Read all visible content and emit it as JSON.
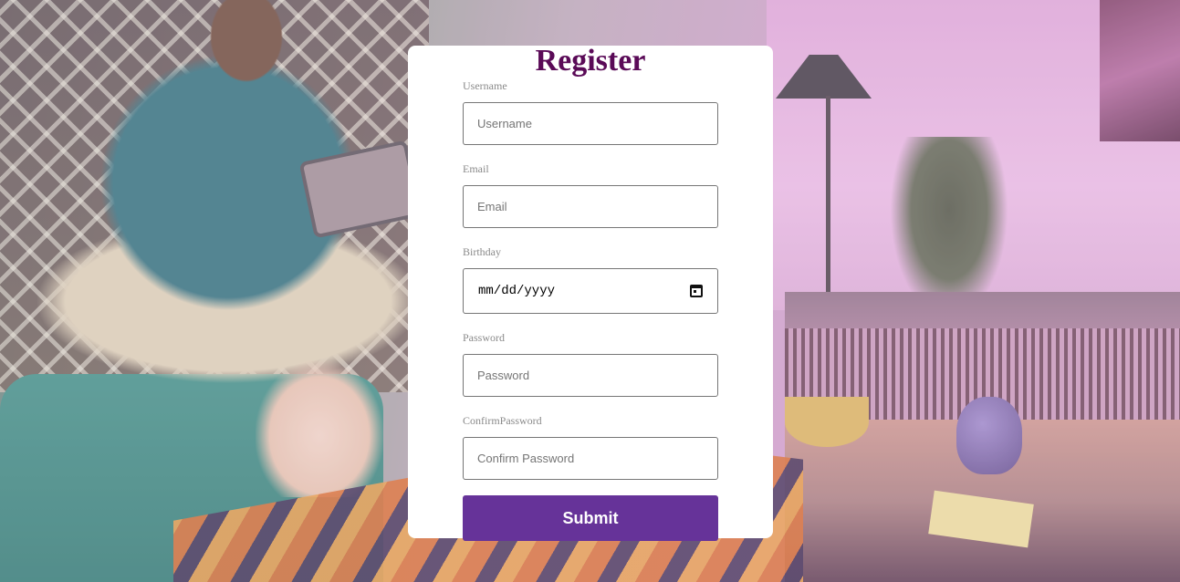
{
  "form": {
    "title": "Register",
    "username": {
      "label": "Username",
      "placeholder": "Username"
    },
    "email": {
      "label": "Email",
      "placeholder": "Email"
    },
    "birthday": {
      "label": "Birthday",
      "value": "mm/dd/yyyy",
      "icon": "calendar-icon"
    },
    "password": {
      "label": "Password",
      "placeholder": "Password"
    },
    "confirm_password": {
      "label": "ConfirmPassword",
      "placeholder": "Confirm Password"
    },
    "submit_label": "Submit"
  },
  "colors": {
    "title": "#5a0a57",
    "submit_bg": "#663399",
    "submit_text": "#ffffff",
    "card_bg": "#ffffff"
  }
}
